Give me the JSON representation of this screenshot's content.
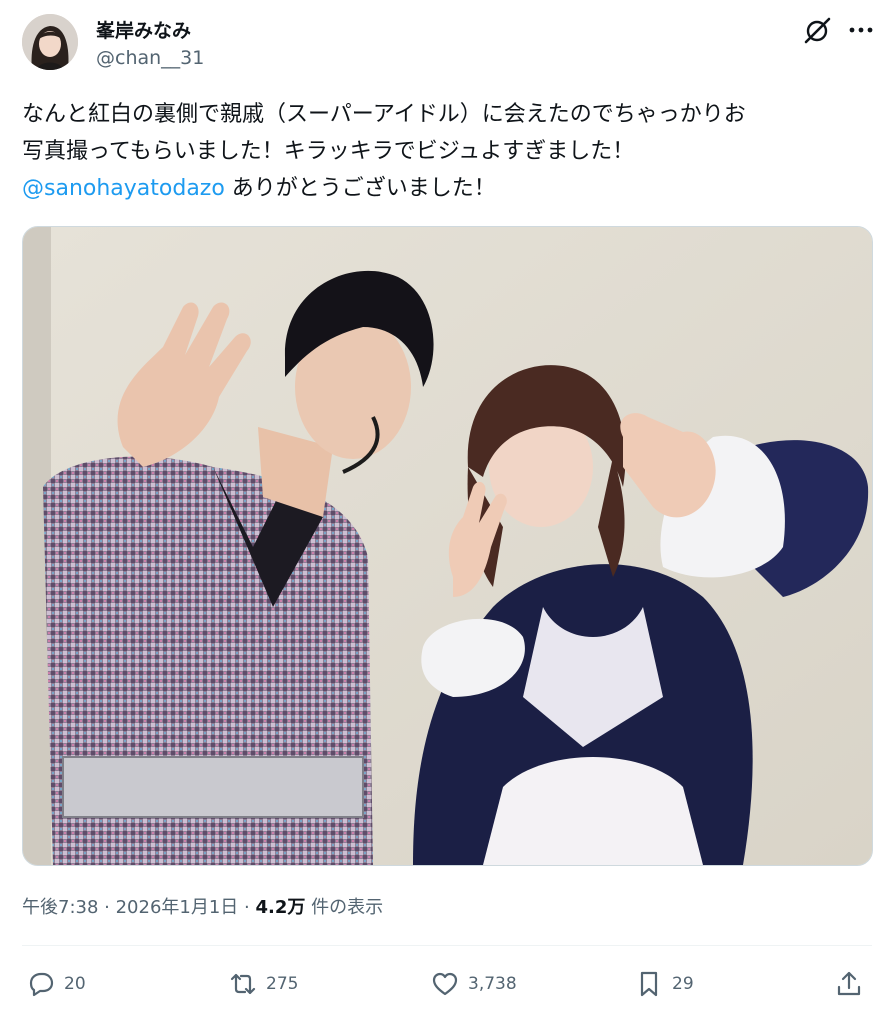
{
  "user": {
    "display_name": "峯岸みなみ",
    "handle": "@chan__31"
  },
  "tweet": {
    "text_line1": "なんと紅白の裏側で親戚（スーパーアイドル）に会えたのでちゃっかりお",
    "text_line2": "写真撮ってもらいました！キラッキラでビジュよすぎました！",
    "mention": "@sanohayatodazo",
    "text_line3_rest": " ありがとうございました！"
  },
  "meta": {
    "time": "午後7:38",
    "separator1": " · ",
    "date": "2026年1月1日",
    "separator2": " · ",
    "views_count": "4.2万",
    "views_label": " 件の表示"
  },
  "actions": {
    "replies": "20",
    "reposts": "275",
    "likes": "3,738",
    "bookmarks": "29"
  },
  "icons": {
    "grok": "grok-icon",
    "more": "more-icon",
    "reply": "reply-icon",
    "repost": "repost-icon",
    "like": "like-icon",
    "bookmark": "bookmark-icon",
    "share": "share-icon"
  },
  "colors": {
    "link": "#1d9bf0",
    "text": "#0f1419",
    "secondary": "#536471"
  }
}
